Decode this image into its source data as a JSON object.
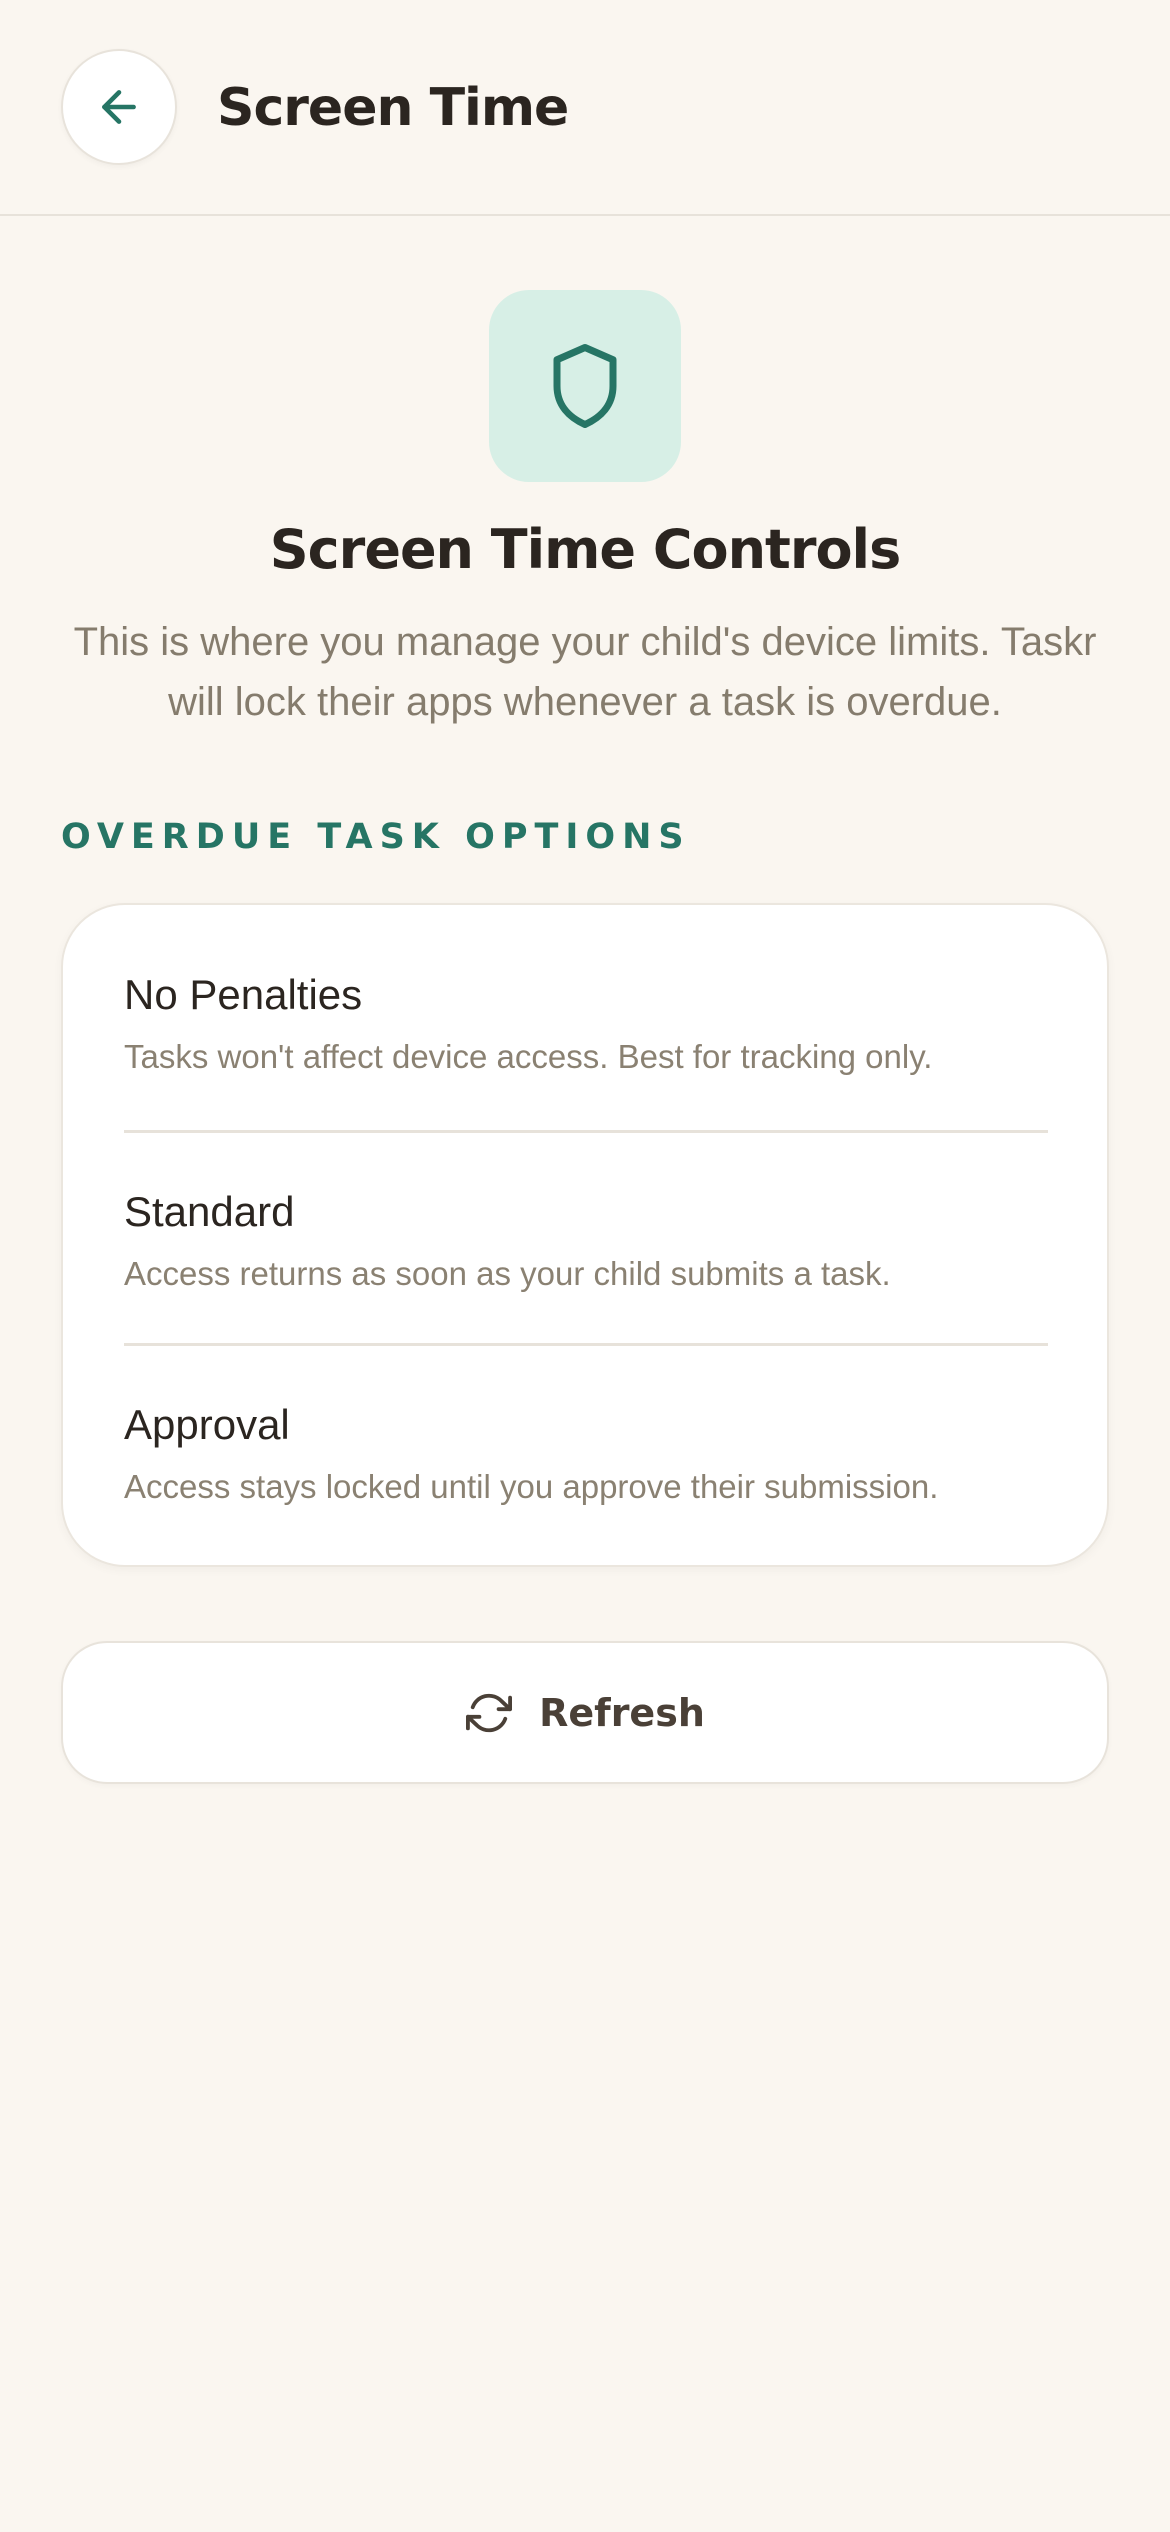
{
  "header": {
    "back_icon": "arrow-left-icon",
    "title": "Screen Time"
  },
  "hero": {
    "icon": "shield-icon",
    "title": "Screen Time Controls",
    "description": "This is where you manage your child's device limits. Taskr will lock their apps whenever a task is overdue."
  },
  "section": {
    "label": "OVERDUE TASK OPTIONS"
  },
  "options": [
    {
      "title": "No Penalties",
      "description": "Tasks won't affect device access. Best for tracking only."
    },
    {
      "title": "Standard",
      "description": "Access returns as soon as your child submits a task."
    },
    {
      "title": "Approval",
      "description": "Access stays locked until you approve their submission."
    }
  ],
  "refresh": {
    "icon": "refresh-icon",
    "label": "Refresh"
  },
  "colors": {
    "background": "#faf6f0",
    "accent": "#267565",
    "accent_light": "#d7efe6",
    "text_primary": "#2b2520",
    "text_secondary": "#857c6d",
    "card": "#ffffff"
  }
}
